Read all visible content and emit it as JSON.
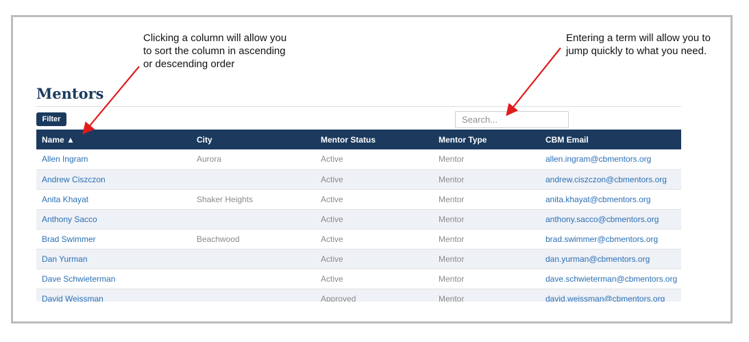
{
  "annotations": {
    "sort_note": [
      "Clicking a column will allow you",
      "to sort the column in ascending",
      "or descending order"
    ],
    "search_note": [
      "Entering a term will allow you to",
      "jump quickly to what you need."
    ]
  },
  "page": {
    "title": "Mentors",
    "filter_label": "Filter",
    "search_placeholder": "Search..."
  },
  "table": {
    "headers": [
      "Name ▲",
      "City",
      "Mentor Status",
      "Mentor Type",
      "CBM Email"
    ],
    "rows": [
      {
        "name": "Allen Ingram",
        "city": "Aurora",
        "status": "Active",
        "type": "Mentor",
        "email": "allen.ingram@cbmentors.org"
      },
      {
        "name": "Andrew Ciszczon",
        "city": "",
        "status": "Active",
        "type": "Mentor",
        "email": "andrew.ciszczon@cbmentors.org"
      },
      {
        "name": "Anita Khayat",
        "city": "Shaker Heights",
        "status": "Active",
        "type": "Mentor",
        "email": "anita.khayat@cbmentors.org"
      },
      {
        "name": "Anthony Sacco",
        "city": "",
        "status": "Active",
        "type": "Mentor",
        "email": "anthony.sacco@cbmentors.org"
      },
      {
        "name": "Brad Swimmer",
        "city": "Beachwood",
        "status": "Active",
        "type": "Mentor",
        "email": "brad.swimmer@cbmentors.org"
      },
      {
        "name": "Dan Yurman",
        "city": "",
        "status": "Active",
        "type": "Mentor",
        "email": "dan.yurman@cbmentors.org"
      },
      {
        "name": "Dave Schwieterman",
        "city": "",
        "status": "Active",
        "type": "Mentor",
        "email": "dave.schwieterman@cbmentors.org"
      },
      {
        "name": "David Weissman",
        "city": "",
        "status": "Approved",
        "type": "Mentor",
        "email": "david.weissman@cbmentors.org"
      }
    ]
  },
  "colors": {
    "header_bg": "#1b3a5e",
    "link": "#2a6fb5",
    "arrow": "#e01b1b",
    "row_alt": "#eef1f6"
  }
}
